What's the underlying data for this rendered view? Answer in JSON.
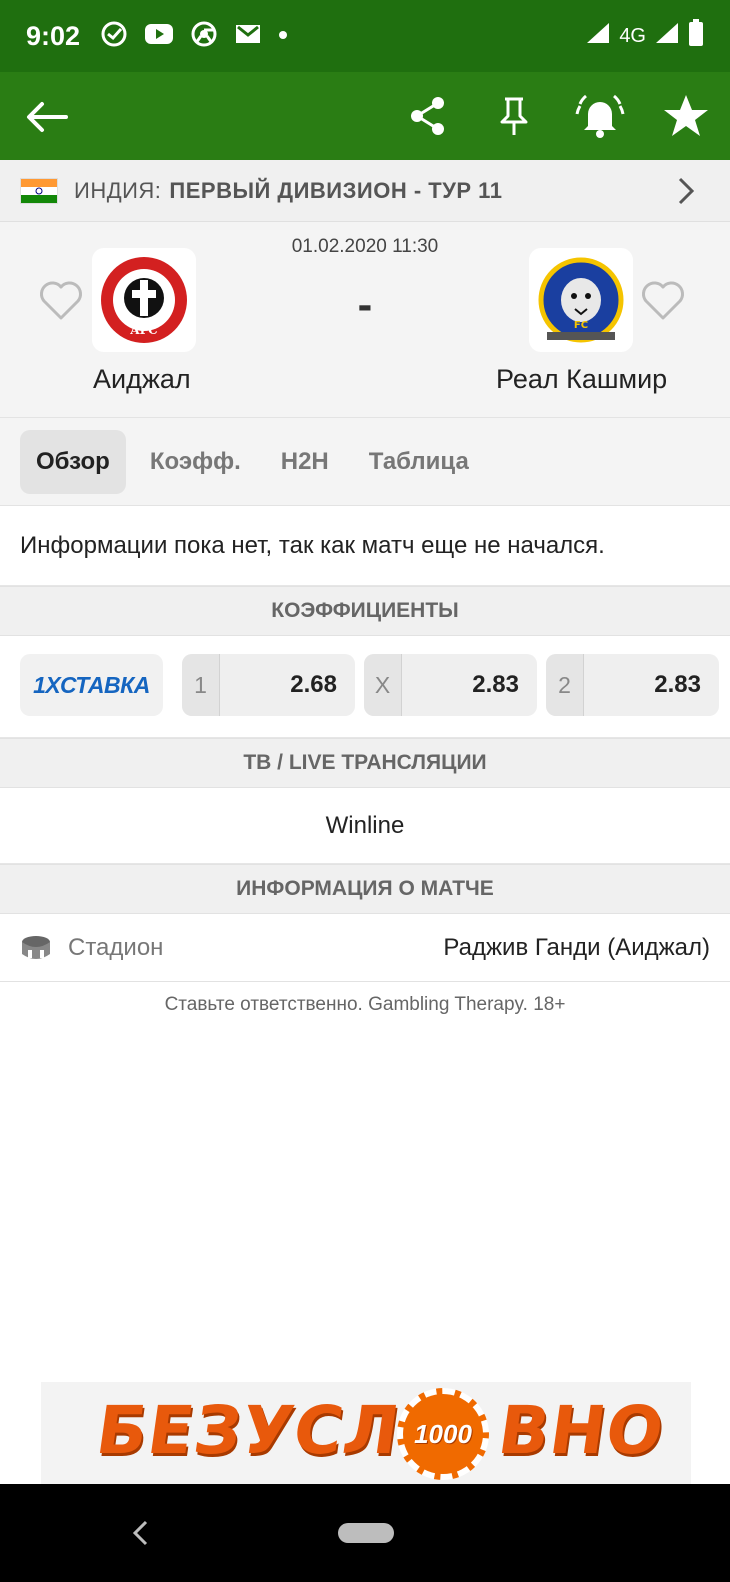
{
  "status_bar": {
    "time": "9:02",
    "network": "4G",
    "icons": [
      "sber-icon",
      "youtube-icon",
      "chrome-icon",
      "gmail-icon",
      "dot-icon",
      "wifi-icon",
      "signal-icon",
      "battery-icon"
    ]
  },
  "toolbar": {
    "icons": [
      "back-arrow-icon",
      "share-icon",
      "pin-icon",
      "bell-icon",
      "star-icon"
    ]
  },
  "league": {
    "country": "ИНДИЯ:",
    "competition": "ПЕРВЫЙ ДИВИЗИОН - ТУР 11"
  },
  "match": {
    "datetime": "01.02.2020 11:30",
    "score": "-",
    "home": {
      "name": "Аиджал",
      "logo_text": "AIZAWL FOOTBALL CLUB",
      "logo_abbr": "AFC"
    },
    "away": {
      "name": "Реал Кашмир",
      "logo_text": "REAL KASHMIR",
      "logo_abbr": "FC"
    }
  },
  "tabs": [
    {
      "label": "Обзор",
      "active": true
    },
    {
      "label": "Коэфф.",
      "active": false
    },
    {
      "label": "H2H",
      "active": false
    },
    {
      "label": "Таблица",
      "active": false
    }
  ],
  "info_text": "Информации пока нет, так как матч еще не начался.",
  "odds_section": {
    "title": "КОЭФФИЦИЕНТЫ",
    "bookmaker": "1ХСТАВКА",
    "odds": [
      {
        "label": "1",
        "value": "2.68"
      },
      {
        "label": "X",
        "value": "2.83"
      },
      {
        "label": "2",
        "value": "2.83"
      }
    ]
  },
  "tv_section": {
    "title": "ТВ / LIVE ТРАНСЛЯЦИИ",
    "channel": "Winline"
  },
  "match_info_section": {
    "title": "ИНФОРМАЦИЯ О МАТЧЕ",
    "stadium_label": "Стадион",
    "stadium_value": "Раджив Ганди (Аиджал)"
  },
  "responsible_text": "Ставьте ответственно. Gambling Therapy. 18+",
  "banner": {
    "left_text": "БЕЗУСЛ",
    "chip_text": "1000",
    "right_text": "ВНО"
  },
  "colors": {
    "status_bar": "#1f6f0f",
    "toolbar": "#2a7d14",
    "accent_orange": "#e8590c",
    "bookmaker_blue": "#1565c0"
  }
}
